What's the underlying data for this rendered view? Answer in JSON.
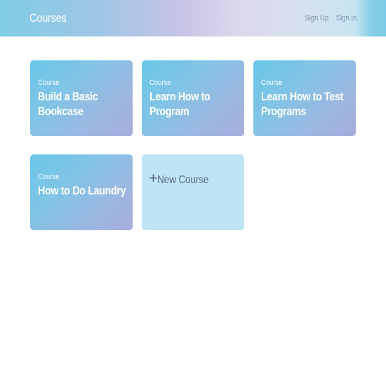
{
  "header": {
    "title": "Courses",
    "sign_up": "Sign Up",
    "sign_in": "Sign In"
  },
  "courses": [
    {
      "label": "Course",
      "title": "Build a Basic Bookcase"
    },
    {
      "label": "Course",
      "title": "Learn How to Program"
    },
    {
      "label": "Course",
      "title": "Learn How to Test Programs"
    },
    {
      "label": "Course",
      "title": "How to Do Laundry"
    }
  ],
  "new_course": {
    "icon": "plus-icon",
    "plus": "+",
    "label": "New Course"
  },
  "colors": {
    "card_gradient_start": "#69c6e8",
    "card_gradient_end": "#a8acde",
    "new_card_bg": "#bee5f4"
  }
}
